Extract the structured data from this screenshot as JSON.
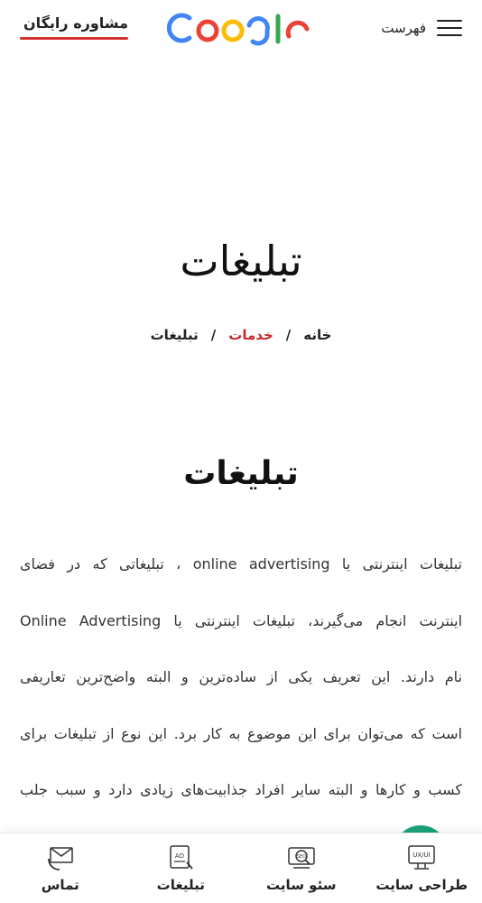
{
  "header": {
    "consult_label": "مشاوره رایگان",
    "menu_label": "فهرست",
    "logo_colors": [
      "#4285F4",
      "#EA4335",
      "#FBBC05",
      "#4285F4",
      "#34A853",
      "#EA4335"
    ]
  },
  "hero": {
    "title": "تبلیغات",
    "breadcrumb": {
      "home": "خانه",
      "services": "خدمات",
      "current": "تبلیغات",
      "separator": "/"
    }
  },
  "content": {
    "section_title": "تبلیغات",
    "lines": [
      "تبلیغات اینترنتی یا online advertising ، تبلیغاتی که در فضای",
      "اینترنت انجام می‌گیرند، تبلیغات اینترنتی یا Online Advertising",
      "نام دارند. این تعریف یکی از ساده‌ترین و البته واضح‌ترین تعاریفی",
      "است که می‌توان برای این موضوع به کار برد. این نوع از تبلیغات برای",
      "کسب و کارها و البته سایر افراد جذابیت‌های زیادی دارد و سبب جلب"
    ]
  },
  "bottom_nav": {
    "items": [
      {
        "label": "طراحی سایت",
        "icon": "ux-ui-monitor-icon"
      },
      {
        "label": "سئو سایت",
        "icon": "seo-magnifier-icon"
      },
      {
        "label": "تبلیغات",
        "icon": "ad-document-icon"
      },
      {
        "label": "تماس",
        "icon": "envelope-phone-icon"
      }
    ]
  },
  "colors": {
    "accent_red": "#c62828",
    "fab_green": "#1aa37a"
  }
}
